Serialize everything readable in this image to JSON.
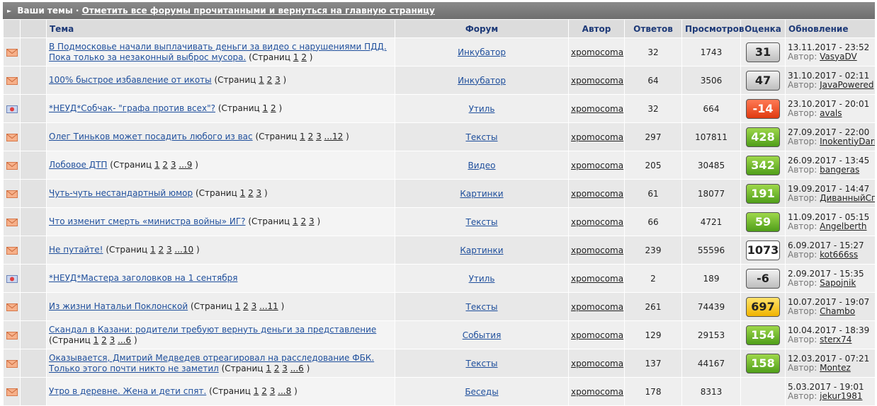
{
  "header": {
    "title": "Ваши темы",
    "separator": " · ",
    "mark_read_link": "Отметить все форумы прочитанными и вернуться на главную страницу"
  },
  "columns": {
    "topic": "Тема",
    "forum": "Форум",
    "author": "Автор",
    "replies": "Ответов",
    "views": "Просмотров",
    "rating": "Оценка",
    "updated": "Обновление"
  },
  "pages_label": "(Страниц",
  "pages_close": ")",
  "by_label": "Автор:",
  "colors": {
    "link": "#1f4f9c",
    "header_bg": "#dcdcdc",
    "header_text": "#1e3a78",
    "rating_green": "#4f9e1a",
    "rating_red": "#e03a10",
    "rating_yellow": "#f0b400"
  },
  "topics": [
    {
      "icon": "envelope-icon",
      "title": "В Подмосковье начали выплачивать деньги за видео с нарушениями ПДД. Пока только за незаконный выброс мусора.",
      "pages": [
        "1",
        "2"
      ],
      "forum": "Инкубатор",
      "author": "xpomocoma",
      "replies": "32",
      "views": "1743",
      "rating": "31",
      "rating_style": "gray",
      "updated": "13.11.2017 - 23:52",
      "last_author": "VasyaDV"
    },
    {
      "icon": "envelope-icon",
      "title": "100% быстрое избавление от икоты",
      "pages": [
        "1",
        "2",
        "3"
      ],
      "forum": "Инкубатор",
      "author": "xpomocoma",
      "replies": "64",
      "views": "3506",
      "rating": "47",
      "rating_style": "gray",
      "updated": "31.10.2017 - 02:11",
      "last_author": "JavaPowered"
    },
    {
      "icon": "poll-icon",
      "title": "*НЕУД*Собчак- \"графа против всех\"?",
      "pages": [
        "1",
        "2"
      ],
      "forum": "Утиль",
      "author": "xpomocoma",
      "replies": "32",
      "views": "664",
      "rating": "-14",
      "rating_style": "red",
      "updated": "23.10.2017 - 20:01",
      "last_author": "avals"
    },
    {
      "icon": "envelope-icon",
      "title": "Олег Тиньков может посадить любого из вас",
      "pages": [
        "1",
        "2",
        "3",
        "...12"
      ],
      "forum": "Тексты",
      "author": "xpomocoma",
      "replies": "297",
      "views": "107811",
      "rating": "428",
      "rating_style": "green",
      "updated": "27.09.2017 - 22:00",
      "last_author": "InokentiyDarmoedoff"
    },
    {
      "icon": "envelope-icon",
      "title": "Лобовое ДТП",
      "pages": [
        "1",
        "2",
        "3",
        "...9"
      ],
      "forum": "Видео",
      "author": "xpomocoma",
      "replies": "205",
      "views": "30485",
      "rating": "342",
      "rating_style": "green",
      "updated": "26.09.2017 - 13:45",
      "last_author": "bangeras"
    },
    {
      "icon": "envelope-icon",
      "title": "Чуть-чуть нестандартный юмор",
      "pages": [
        "1",
        "2",
        "3"
      ],
      "forum": "Картинки",
      "author": "xpomocoma",
      "replies": "61",
      "views": "18077",
      "rating": "191",
      "rating_style": "green",
      "updated": "19.09.2017 - 14:47",
      "last_author": "ДиванныйСпец"
    },
    {
      "icon": "envelope-icon",
      "title": "Что изменит смерть «министра войны» ИГ?",
      "pages": [
        "1",
        "2",
        "3"
      ],
      "forum": "Тексты",
      "author": "xpomocoma",
      "replies": "66",
      "views": "4721",
      "rating": "59",
      "rating_style": "green",
      "updated": "11.09.2017 - 05:15",
      "last_author": "Angelberth"
    },
    {
      "icon": "envelope-icon",
      "title": "Не путайте!",
      "pages": [
        "1",
        "2",
        "3",
        "...10"
      ],
      "forum": "Картинки",
      "author": "xpomocoma",
      "replies": "239",
      "views": "55596",
      "rating": "1073",
      "rating_style": "white",
      "updated": "6.09.2017 - 15:27",
      "last_author": "kot666ss"
    },
    {
      "icon": "poll-icon",
      "title": "*НЕУД*Мастера заголовков на 1 сентября",
      "pages": [],
      "forum": "Утиль",
      "author": "xpomocoma",
      "replies": "2",
      "views": "189",
      "rating": "-6",
      "rating_style": "gray",
      "updated": "2.09.2017 - 15:35",
      "last_author": "Sapojnik"
    },
    {
      "icon": "envelope-icon",
      "title": "Из жизни Натальи Поклонской",
      "pages": [
        "1",
        "2",
        "3",
        "...11"
      ],
      "forum": "Тексты",
      "author": "xpomocoma",
      "replies": "261",
      "views": "74439",
      "rating": "697",
      "rating_style": "yellow",
      "updated": "10.07.2017 - 19:07",
      "last_author": "Chambo"
    },
    {
      "icon": "envelope-icon",
      "title": "Скандал в Казани: родители требуют вернуть деньги за представление",
      "pages": [
        "1",
        "2",
        "3",
        "...6"
      ],
      "forum": "События",
      "author": "xpomocoma",
      "replies": "129",
      "views": "29153",
      "rating": "154",
      "rating_style": "green",
      "updated": "10.04.2017 - 18:39",
      "last_author": "sterx74"
    },
    {
      "icon": "envelope-icon",
      "title": "Оказывается, Дмитрий Медведев отреагировал на расследование ФБК. Только этого почти никто не заметил",
      "pages": [
        "1",
        "2",
        "3",
        "...6"
      ],
      "forum": "Тексты",
      "author": "xpomocoma",
      "replies": "137",
      "views": "44167",
      "rating": "158",
      "rating_style": "green",
      "updated": "12.03.2017 - 07:21",
      "last_author": "Montez"
    },
    {
      "icon": "envelope-icon",
      "title": "Утро в деревне. Жена и дети спят.",
      "pages": [
        "1",
        "2",
        "3",
        "...8"
      ],
      "forum": "Беседы",
      "author": "xpomocoma",
      "replies": "178",
      "views": "8313",
      "rating": "",
      "rating_style": "none",
      "updated": "5.03.2017 - 19:01",
      "last_author": "jekur1981"
    }
  ]
}
